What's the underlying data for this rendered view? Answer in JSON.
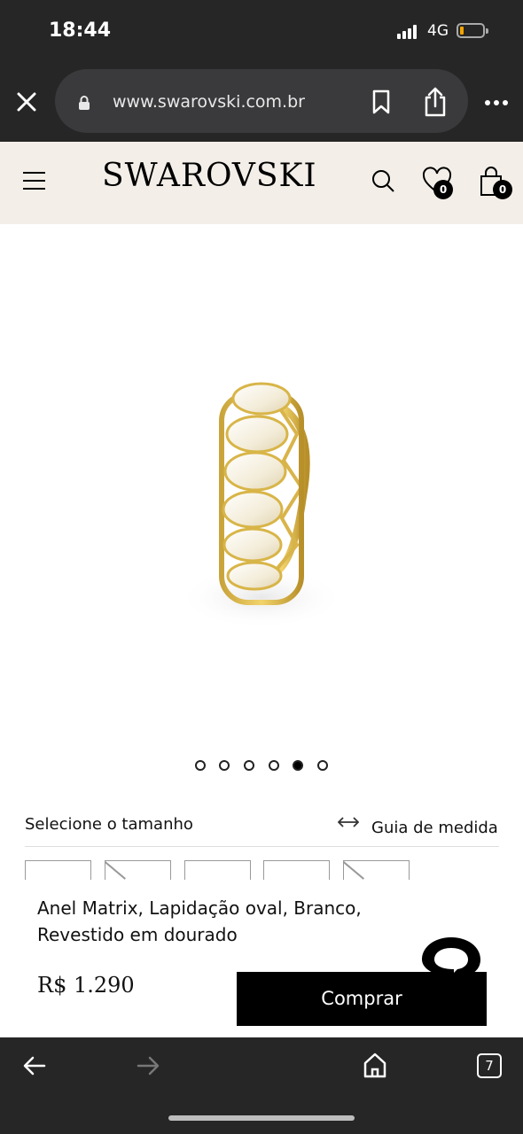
{
  "status": {
    "time": "18:44",
    "network": "4G"
  },
  "browser": {
    "url": "www.swarovski.com.br",
    "tab_count": "7"
  },
  "header": {
    "logo": "SWAROVSKI",
    "wishlist_count": "0",
    "bag_count": "0"
  },
  "gallery": {
    "image_count": 6,
    "active_index": 4
  },
  "size": {
    "label": "Selecione o tamanho",
    "guide_label": "Guia de medida"
  },
  "product": {
    "name": "Anel Matrix, Lapidação oval, Branco, Revestido em dourado",
    "price": "R$ 1.290",
    "buy_label": "Comprar"
  },
  "icons": [
    "close-icon",
    "lock-icon",
    "bookmark-icon",
    "share-icon",
    "more-icon",
    "menu-icon",
    "search-icon",
    "heart-icon",
    "bag-icon",
    "swap-arrows-icon",
    "chat-icon",
    "back-arrow-icon",
    "forward-arrow-icon",
    "home-icon",
    "tabs-icon"
  ],
  "colors": {
    "browser_bg": "#262626",
    "header_bg": "#f3efe8",
    "button_bg": "#000000",
    "battery": "#f2a400"
  }
}
